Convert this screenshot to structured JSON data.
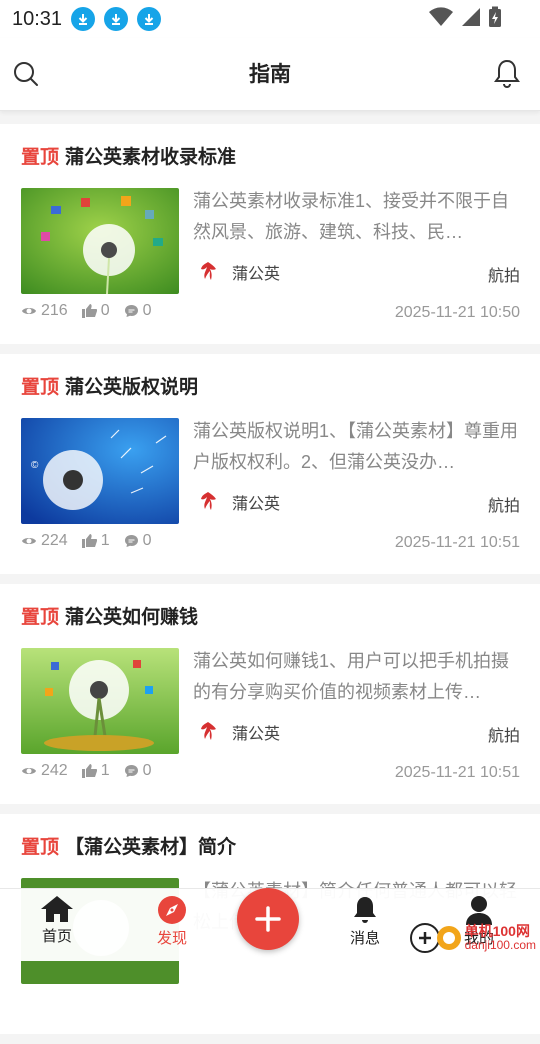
{
  "status_bar": {
    "time": "10:31",
    "download_icons": 3
  },
  "header": {
    "title": "指南"
  },
  "colors": {
    "accent": "#e8453c",
    "download_badge": "#16a4e8"
  },
  "posts": [
    {
      "pin": "置顶",
      "title": "蒲公英素材收录标准",
      "summary": "蒲公英素材收录标准1、接受并不限于自然风景、旅游、建筑、科技、民…",
      "author": "蒲公英",
      "tag": "航拍",
      "views": "216",
      "likes": "0",
      "comments": "0",
      "date": "2025-11-21 10:50",
      "thumb": "dandelion-icons-green"
    },
    {
      "pin": "置顶",
      "title": "蒲公英版权说明",
      "summary": "蒲公英版权说明1、【蒲公英素材】尊重用户版权权利。2、但蒲公英没办…",
      "author": "蒲公英",
      "tag": "航拍",
      "views": "224",
      "likes": "1",
      "comments": "0",
      "date": "2025-11-21 10:51",
      "thumb": "dandelion-blue"
    },
    {
      "pin": "置顶",
      "title": "蒲公英如何赚钱",
      "summary": "蒲公英如何赚钱1、用户可以把手机拍摄的有分享购买价值的视频素材上传…",
      "author": "蒲公英",
      "tag": "航拍",
      "views": "242",
      "likes": "1",
      "comments": "0",
      "date": "2025-11-21 10:51",
      "thumb": "dandelion-money"
    },
    {
      "pin": "置顶",
      "title": "【蒲公英素材】简介",
      "summary": "【蒲公英素材】简介任何普通人都可以轻松上传赚钱",
      "author": "",
      "tag": "",
      "views": "",
      "likes": "",
      "comments": "",
      "date": "",
      "thumb": "dandelion-green"
    }
  ],
  "bottom_nav": {
    "home": "首页",
    "discover": "发现",
    "messages": "消息",
    "mine": "我的"
  },
  "watermark": {
    "main": "单机100网",
    "sub": "danji100.com"
  }
}
